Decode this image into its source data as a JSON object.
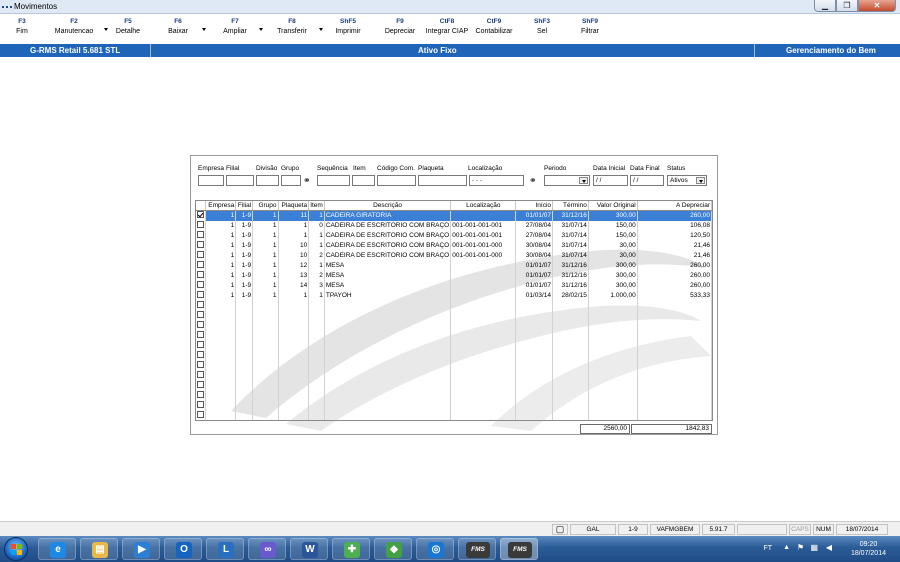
{
  "window": {
    "title": "Movimentos"
  },
  "toolbar": [
    {
      "key": "F3",
      "label": "Fim"
    },
    {
      "key": "F2",
      "label": "Manutencao"
    },
    {
      "key": "F5",
      "label": "Detalhe"
    },
    {
      "key": "F6",
      "label": "Baixar"
    },
    {
      "key": "F7",
      "label": "Ampliar"
    },
    {
      "key": "F8",
      "label": "Transferir"
    },
    {
      "key": "ShF5",
      "label": "Imprimir"
    },
    {
      "key": "F9",
      "label": "Depreciar"
    },
    {
      "key": "CtF8",
      "label": "Integrar CIAP"
    },
    {
      "key": "CtF9",
      "label": "Contabilizar"
    },
    {
      "key": "ShF3",
      "label": "Sel"
    },
    {
      "key": "ShF9",
      "label": "Filtrar"
    }
  ],
  "banner": {
    "left": "G-RMS Retail 5.681 STL",
    "center": "Ativo Fixo",
    "right": "Gerenciamento do Bem"
  },
  "filters": {
    "labels": [
      "Empresa",
      "Filial",
      "Divisão",
      "Grupo",
      "Sequência",
      "Item",
      "Código Com.",
      "Plaqueta",
      "Localização",
      "Periodo",
      "Data Inicial",
      "Data Final",
      "Status"
    ],
    "localizacao_mask": " -  -  - ",
    "data_inicial": " / /",
    "data_final": " / /",
    "status": "Ativos"
  },
  "grid": {
    "columns": [
      "",
      "Empresa",
      "Filial",
      "Grupo",
      "Plaqueta",
      "Item",
      "Descrição",
      "Localização",
      "Início",
      "Término",
      "Valor Original",
      "A Depreciar"
    ],
    "rows": [
      {
        "checked": true,
        "empresa": "1",
        "filial": "1-9",
        "grupo": "1",
        "plaqueta": "11",
        "item": "1",
        "descricao": "CADEIRA GIRATORIA",
        "localizacao": "",
        "inicio": "01/01/07",
        "termino": "31/12/16",
        "valor": "300,00",
        "depreciar": "260,00"
      },
      {
        "checked": false,
        "empresa": "1",
        "filial": "1-9",
        "grupo": "1",
        "plaqueta": "1",
        "item": "0",
        "descricao": "CADEIRA DE ESCRITORIO COM BRAÇO",
        "localizacao": "001-001-001-001",
        "inicio": "27/08/04",
        "termino": "31/07/14",
        "valor": "150,00",
        "depreciar": "106,08"
      },
      {
        "checked": false,
        "empresa": "1",
        "filial": "1-9",
        "grupo": "1",
        "plaqueta": "1",
        "item": "1",
        "descricao": "CADEIRA DE ESCRITORIO COM BRAÇO",
        "localizacao": "001-001-001-001",
        "inicio": "27/08/04",
        "termino": "31/07/14",
        "valor": "150,00",
        "depreciar": "120,50"
      },
      {
        "checked": false,
        "empresa": "1",
        "filial": "1-9",
        "grupo": "1",
        "plaqueta": "10",
        "item": "1",
        "descricao": "CADEIRA DE ESCRITORIO COM BRAÇO",
        "localizacao": "001-001-001-000",
        "inicio": "30/08/04",
        "termino": "31/07/14",
        "valor": "30,00",
        "depreciar": "21,46"
      },
      {
        "checked": false,
        "empresa": "1",
        "filial": "1-9",
        "grupo": "1",
        "plaqueta": "10",
        "item": "2",
        "descricao": "CADEIRA DE ESCRITORIO COM BRAÇO",
        "localizacao": "001-001-001-000",
        "inicio": "30/08/04",
        "termino": "31/07/14",
        "valor": "30,00",
        "depreciar": "21,46"
      },
      {
        "checked": false,
        "empresa": "1",
        "filial": "1-9",
        "grupo": "1",
        "plaqueta": "12",
        "item": "1",
        "descricao": "MESA",
        "localizacao": "",
        "inicio": "01/01/07",
        "termino": "31/12/16",
        "valor": "300,00",
        "depreciar": "260,00"
      },
      {
        "checked": false,
        "empresa": "1",
        "filial": "1-9",
        "grupo": "1",
        "plaqueta": "13",
        "item": "2",
        "descricao": "MESA",
        "localizacao": "",
        "inicio": "01/01/07",
        "termino": "31/12/16",
        "valor": "300,00",
        "depreciar": "260,00"
      },
      {
        "checked": false,
        "empresa": "1",
        "filial": "1-9",
        "grupo": "1",
        "plaqueta": "14",
        "item": "3",
        "descricao": "MESA",
        "localizacao": "",
        "inicio": "01/01/07",
        "termino": "31/12/16",
        "valor": "300,00",
        "depreciar": "260,00"
      },
      {
        "checked": false,
        "empresa": "1",
        "filial": "1-9",
        "grupo": "1",
        "plaqueta": "1",
        "item": "1",
        "descricao": "TPAYOH",
        "localizacao": "",
        "inicio": "01/03/14",
        "termino": "28/02/15",
        "valor": "1.000,00",
        "depreciar": "533,33"
      }
    ],
    "empty_rows": 12,
    "total_valor": "2560,00",
    "total_depreciar": "1842,83"
  },
  "statusbar": {
    "gal": "GAL",
    "filial": "1-9",
    "user": "VAFMGBEM",
    "version": "5.91.7",
    "caps": "CAPS",
    "num": "NUM",
    "date": "18/07/2014"
  },
  "taskbar": {
    "lang": "FT",
    "time": "09:20",
    "date": "18/07/2014",
    "apps": [
      "ie-icon",
      "explorer-icon",
      "media-icon",
      "outlook-icon",
      "lync-icon",
      "app-icon",
      "word-icon",
      "green-plus-icon",
      "green-app-icon",
      "globe-icon",
      "FMS",
      "FMS"
    ]
  }
}
